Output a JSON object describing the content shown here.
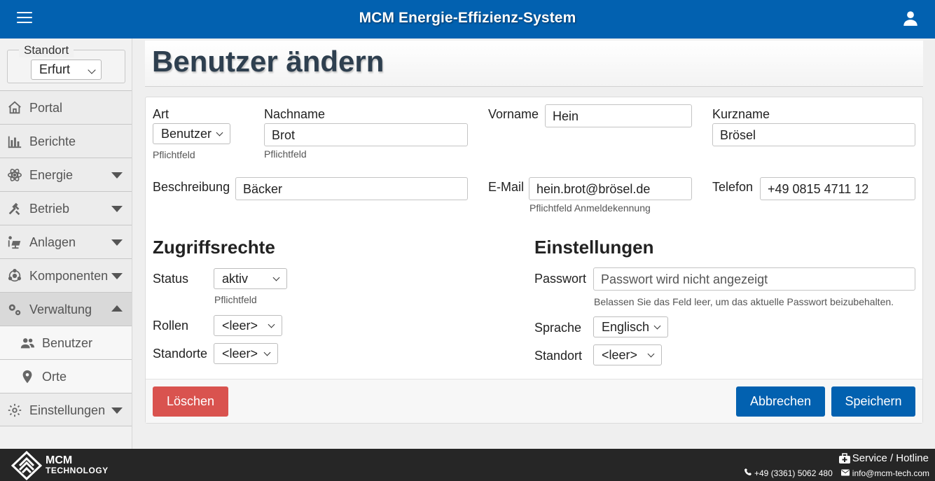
{
  "header": {
    "title": "MCM Energie-Effizienz-System",
    "menu_icon": "hamburger-menu-icon",
    "user_icon": "user-account-icon"
  },
  "sidebar": {
    "site_legend": "Standort",
    "site_value": "Erfurt",
    "items": [
      {
        "label": "Portal",
        "icon": "home-icon"
      },
      {
        "label": "Berichte",
        "icon": "bar-chart-icon"
      },
      {
        "label": "Energie",
        "icon": "atom-icon"
      },
      {
        "label": "Betrieb",
        "icon": "tools-icon"
      },
      {
        "label": "Anlagen",
        "icon": "solar-panel-icon"
      },
      {
        "label": "Komponenten",
        "icon": "network-icon"
      },
      {
        "label": "Verwaltung",
        "icon": "gears-icon"
      },
      {
        "label": "Benutzer",
        "icon": "users-icon"
      },
      {
        "label": "Orte",
        "icon": "location-pin-icon"
      },
      {
        "label": "Einstellungen",
        "icon": "settings-icon"
      }
    ]
  },
  "page": {
    "title": "Benutzer ändern"
  },
  "form": {
    "art": {
      "label": "Art",
      "value": "Benutzer",
      "hint": "Pflichtfeld"
    },
    "nachname": {
      "label": "Nachname",
      "value": "Brot",
      "hint": "Pflichtfeld"
    },
    "vorname": {
      "label": "Vorname",
      "value": "Hein"
    },
    "kurzname": {
      "label": "Kurzname",
      "value": "Brösel"
    },
    "beschreibung": {
      "label": "Beschreibung",
      "value": "Bäcker"
    },
    "email": {
      "label": "E-Mail",
      "value": "hein.brot@brösel.de",
      "hint": "Pflichtfeld Anmeldekennung"
    },
    "telefon": {
      "label": "Telefon",
      "value": "+49 0815 4711 12"
    }
  },
  "access": {
    "heading": "Zugriffsrechte",
    "status": {
      "label": "Status",
      "value": "aktiv",
      "hint": "Pflichtfeld"
    },
    "rollen": {
      "label": "Rollen",
      "value": "<leer>"
    },
    "standorte": {
      "label": "Standorte",
      "value": "<leer>"
    }
  },
  "settings": {
    "heading": "Einstellungen",
    "passwort": {
      "label": "Passwort",
      "placeholder": "Passwort wird nicht angezeigt",
      "hint": "Belassen Sie das Feld leer, um das aktuelle Passwort beizubehalten."
    },
    "sprache": {
      "label": "Sprache",
      "value": "Englisch"
    },
    "standort": {
      "label": "Standort",
      "value": "<leer>"
    }
  },
  "actions": {
    "delete": "Löschen",
    "cancel": "Abbrechen",
    "save": "Speichern"
  },
  "footer": {
    "brand_line1": "MCM",
    "brand_line2": "TECHNOLOGY",
    "service": "Service / Hotline",
    "phone": "+49 (3361) 5062 480",
    "email": "info@mcm-tech.com",
    "colors": {
      "header": "#0261b0",
      "danger": "#d9534f",
      "footer": "#262626"
    }
  }
}
